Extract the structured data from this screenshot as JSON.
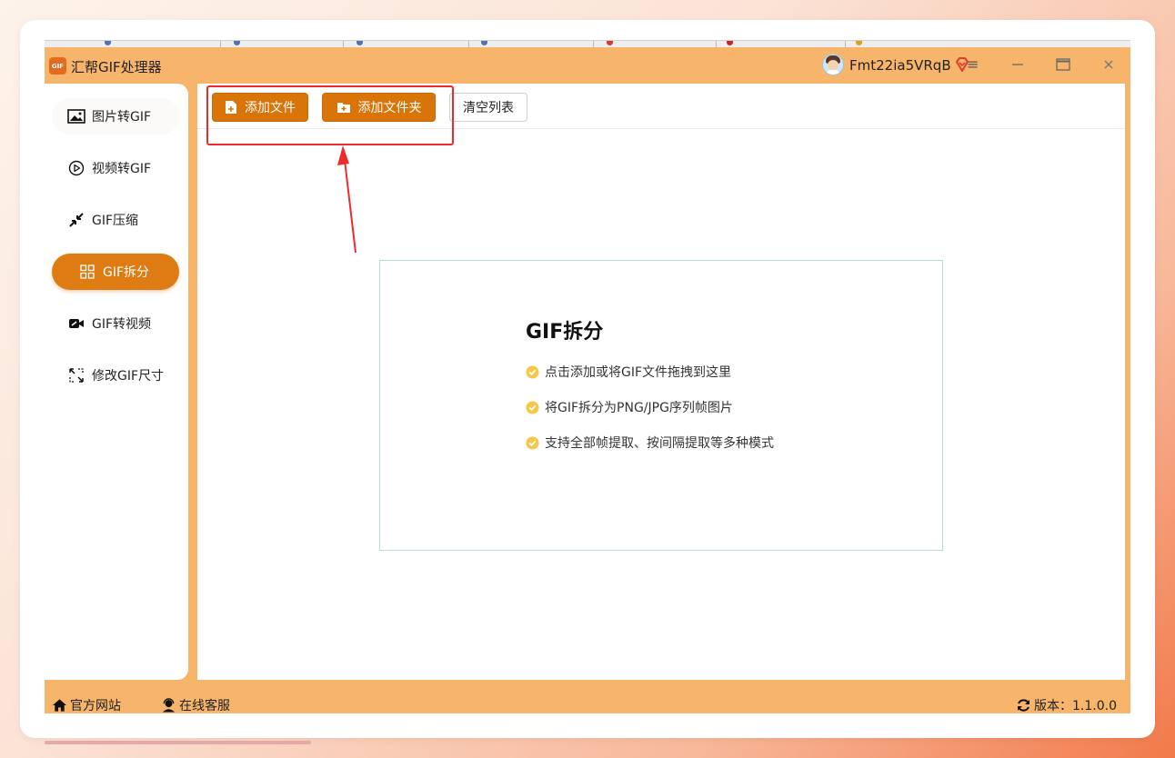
{
  "app": {
    "title": "汇帮GIF处理器",
    "logo_text": "GIF"
  },
  "user": {
    "name": "Fmt22ia5VRqB"
  },
  "sidebar": {
    "items": [
      {
        "label": "图片转GIF",
        "icon": "image-icon",
        "active": false
      },
      {
        "label": "视频转GIF",
        "icon": "play-icon",
        "active": false
      },
      {
        "label": "GIF压缩",
        "icon": "compress-icon",
        "active": false
      },
      {
        "label": "GIF拆分",
        "icon": "split-grid-icon",
        "active": true
      },
      {
        "label": "GIF转视频",
        "icon": "video-camera-icon",
        "active": false
      },
      {
        "label": "修改GIF尺寸",
        "icon": "resize-icon",
        "active": false
      }
    ]
  },
  "toolbar": {
    "add_file": "添加文件",
    "add_folder": "添加文件夹",
    "clear_list": "清空列表"
  },
  "dropzone": {
    "title": "GIF拆分",
    "lines": [
      "点击添加或将GIF文件拖拽到这里",
      "将GIF拆分为PNG/JPG序列帧图片",
      "支持全部帧提取、按间隔提取等多种模式"
    ]
  },
  "footer": {
    "website": "官方网站",
    "support": "在线客服",
    "version": "版本：1.1.0.0"
  },
  "colors": {
    "accent": "#de7b12",
    "frame": "#f7b56b",
    "annotation": "#ee2b2b",
    "check": "#f5c84a"
  }
}
